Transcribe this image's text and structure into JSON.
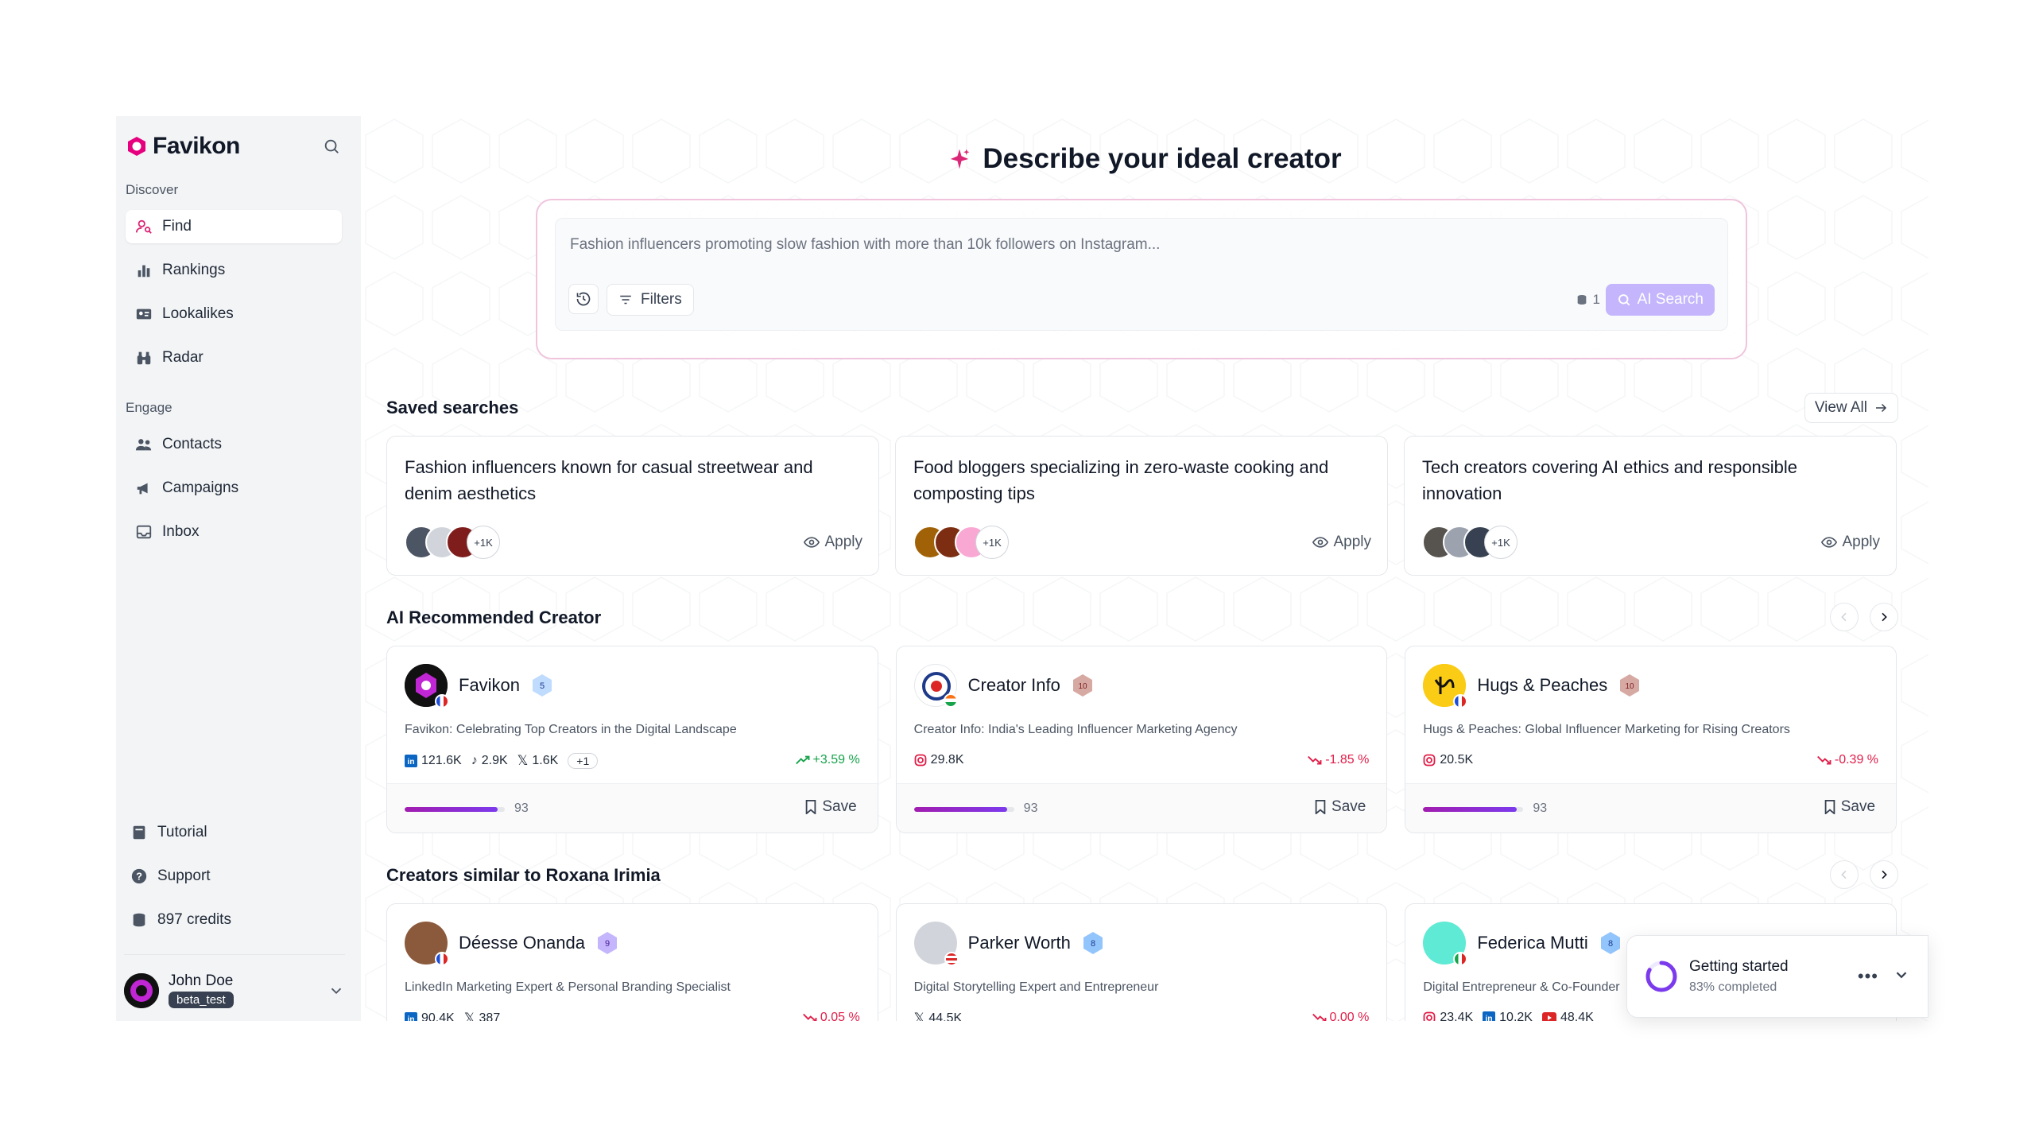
{
  "app": {
    "name": "Favikon"
  },
  "sidebar": {
    "discover_label": "Discover",
    "discover_items": [
      {
        "label": "Find",
        "icon": "user-search-icon",
        "active": true
      },
      {
        "label": "Rankings",
        "icon": "bar-chart-icon"
      },
      {
        "label": "Lookalikes",
        "icon": "id-card-icon"
      },
      {
        "label": "Radar",
        "icon": "binoculars-icon"
      }
    ],
    "engage_label": "Engage",
    "engage_items": [
      {
        "label": "Contacts",
        "icon": "users-icon"
      },
      {
        "label": "Campaigns",
        "icon": "megaphone-icon"
      },
      {
        "label": "Inbox",
        "icon": "inbox-icon"
      }
    ],
    "bottom_items": [
      {
        "label": "Tutorial",
        "icon": "book-icon"
      },
      {
        "label": "Support",
        "icon": "help-icon"
      },
      {
        "label": "897 credits",
        "icon": "coins-icon"
      }
    ],
    "user": {
      "name": "John Doe",
      "badge": "beta_test"
    }
  },
  "hero": {
    "title": "Describe your ideal creator"
  },
  "search": {
    "placeholder": "Fashion influencers promoting slow fashion with more than 10k followers on Instagram...",
    "filters_label": "Filters",
    "credit_cost": "1",
    "ai_search_label": "AI Search"
  },
  "saved_searches": {
    "title": "Saved searches",
    "view_all_label": "View All",
    "items": [
      {
        "text": "Fashion influencers known for casual streetwear and denim aesthetics",
        "more": "+1K",
        "apply": "Apply"
      },
      {
        "text": "Food bloggers specializing in zero-waste cooking and composting tips",
        "more": "+1K",
        "apply": "Apply"
      },
      {
        "text": "Tech creators covering AI ethics and responsible innovation",
        "more": "+1K",
        "apply": "Apply"
      }
    ]
  },
  "recommended": {
    "title": "AI Recommended Creator",
    "cards": [
      {
        "name": "Favikon",
        "level": "5",
        "desc": "Favikon: Celebrating Top Creators in the Digital Landscape",
        "stats": [
          {
            "icon": "linkedin-icon",
            "value": "121.6K"
          },
          {
            "icon": "tiktok-icon",
            "value": "2.9K"
          },
          {
            "icon": "x-icon",
            "value": "1.6K"
          }
        ],
        "extra": "+1",
        "growth": "+3.59 %",
        "trend": "up",
        "score": "93",
        "score_fraction": 0.93,
        "save": "Save"
      },
      {
        "name": "Creator Info",
        "level": "10",
        "desc": "Creator Info: India's Leading Influencer Marketing Agency",
        "stats": [
          {
            "icon": "instagram-icon",
            "value": "29.8K"
          }
        ],
        "growth": "-1.85 %",
        "trend": "down",
        "score": "93",
        "score_fraction": 0.93,
        "save": "Save"
      },
      {
        "name": "Hugs & Peaches",
        "level": "10",
        "desc": "Hugs & Peaches: Global Influencer Marketing for Rising Creators",
        "stats": [
          {
            "icon": "instagram-icon",
            "value": "20.5K"
          }
        ],
        "growth": "-0.39 %",
        "trend": "down",
        "score": "93",
        "score_fraction": 0.93,
        "save": "Save"
      }
    ]
  },
  "similar": {
    "title": "Creators similar to Roxana Irimia",
    "cards": [
      {
        "name": "Déesse Onanda",
        "level": "9",
        "desc": "LinkedIn Marketing Expert & Personal Branding Specialist",
        "stats": [
          {
            "icon": "linkedin-icon",
            "value": "90.4K"
          },
          {
            "icon": "x-icon",
            "value": "387"
          }
        ],
        "growth": "0.05 %",
        "trend": "down"
      },
      {
        "name": "Parker Worth",
        "level": "8",
        "desc": "Digital Storytelling Expert and Entrepreneur",
        "stats": [
          {
            "icon": "x-icon",
            "value": "44.5K"
          }
        ],
        "growth": "0.00 %",
        "trend": "down"
      },
      {
        "name": "Federica Mutti",
        "level": "8",
        "desc": "Digital Entrepreneur & Co-Founder",
        "stats": [
          {
            "icon": "instagram-icon",
            "value": "23.4K"
          },
          {
            "icon": "linkedin-icon",
            "value": "10.2K"
          },
          {
            "icon": "youtube-icon",
            "value": "48.4K"
          }
        ],
        "growth": "",
        "trend": "down"
      }
    ]
  },
  "toast": {
    "title": "Getting started",
    "subtitle": "83% completed",
    "progress": 0.83
  },
  "colors": {
    "brand": "#e6007e",
    "accent": "#7c3aed",
    "up": "#16a34a",
    "down": "#e11d48"
  }
}
